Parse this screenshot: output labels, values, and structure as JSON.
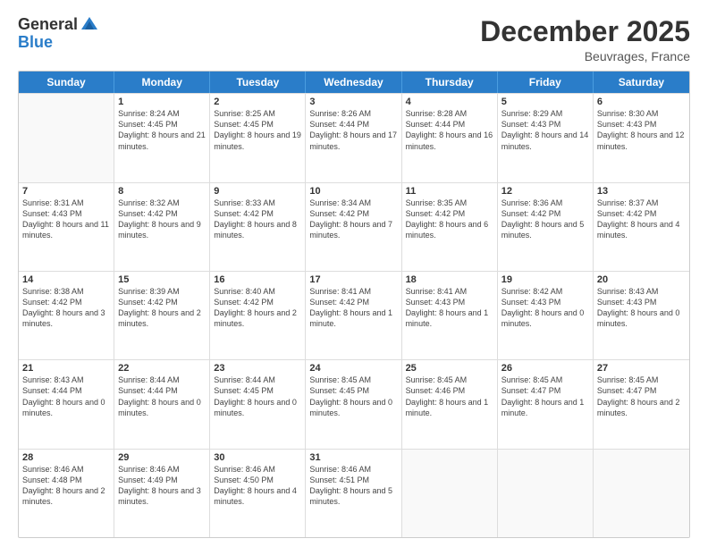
{
  "logo": {
    "general": "General",
    "blue": "Blue"
  },
  "title": {
    "month": "December 2025",
    "location": "Beuvrages, France"
  },
  "weekdays": [
    "Sunday",
    "Monday",
    "Tuesday",
    "Wednesday",
    "Thursday",
    "Friday",
    "Saturday"
  ],
  "weeks": [
    [
      {
        "day": "",
        "sunrise": "",
        "sunset": "",
        "daylight": "",
        "empty": true
      },
      {
        "day": "1",
        "sunrise": "Sunrise: 8:24 AM",
        "sunset": "Sunset: 4:45 PM",
        "daylight": "Daylight: 8 hours and 21 minutes.",
        "empty": false
      },
      {
        "day": "2",
        "sunrise": "Sunrise: 8:25 AM",
        "sunset": "Sunset: 4:45 PM",
        "daylight": "Daylight: 8 hours and 19 minutes.",
        "empty": false
      },
      {
        "day": "3",
        "sunrise": "Sunrise: 8:26 AM",
        "sunset": "Sunset: 4:44 PM",
        "daylight": "Daylight: 8 hours and 17 minutes.",
        "empty": false
      },
      {
        "day": "4",
        "sunrise": "Sunrise: 8:28 AM",
        "sunset": "Sunset: 4:44 PM",
        "daylight": "Daylight: 8 hours and 16 minutes.",
        "empty": false
      },
      {
        "day": "5",
        "sunrise": "Sunrise: 8:29 AM",
        "sunset": "Sunset: 4:43 PM",
        "daylight": "Daylight: 8 hours and 14 minutes.",
        "empty": false
      },
      {
        "day": "6",
        "sunrise": "Sunrise: 8:30 AM",
        "sunset": "Sunset: 4:43 PM",
        "daylight": "Daylight: 8 hours and 12 minutes.",
        "empty": false
      }
    ],
    [
      {
        "day": "7",
        "sunrise": "Sunrise: 8:31 AM",
        "sunset": "Sunset: 4:43 PM",
        "daylight": "Daylight: 8 hours and 11 minutes.",
        "empty": false
      },
      {
        "day": "8",
        "sunrise": "Sunrise: 8:32 AM",
        "sunset": "Sunset: 4:42 PM",
        "daylight": "Daylight: 8 hours and 9 minutes.",
        "empty": false
      },
      {
        "day": "9",
        "sunrise": "Sunrise: 8:33 AM",
        "sunset": "Sunset: 4:42 PM",
        "daylight": "Daylight: 8 hours and 8 minutes.",
        "empty": false
      },
      {
        "day": "10",
        "sunrise": "Sunrise: 8:34 AM",
        "sunset": "Sunset: 4:42 PM",
        "daylight": "Daylight: 8 hours and 7 minutes.",
        "empty": false
      },
      {
        "day": "11",
        "sunrise": "Sunrise: 8:35 AM",
        "sunset": "Sunset: 4:42 PM",
        "daylight": "Daylight: 8 hours and 6 minutes.",
        "empty": false
      },
      {
        "day": "12",
        "sunrise": "Sunrise: 8:36 AM",
        "sunset": "Sunset: 4:42 PM",
        "daylight": "Daylight: 8 hours and 5 minutes.",
        "empty": false
      },
      {
        "day": "13",
        "sunrise": "Sunrise: 8:37 AM",
        "sunset": "Sunset: 4:42 PM",
        "daylight": "Daylight: 8 hours and 4 minutes.",
        "empty": false
      }
    ],
    [
      {
        "day": "14",
        "sunrise": "Sunrise: 8:38 AM",
        "sunset": "Sunset: 4:42 PM",
        "daylight": "Daylight: 8 hours and 3 minutes.",
        "empty": false
      },
      {
        "day": "15",
        "sunrise": "Sunrise: 8:39 AM",
        "sunset": "Sunset: 4:42 PM",
        "daylight": "Daylight: 8 hours and 2 minutes.",
        "empty": false
      },
      {
        "day": "16",
        "sunrise": "Sunrise: 8:40 AM",
        "sunset": "Sunset: 4:42 PM",
        "daylight": "Daylight: 8 hours and 2 minutes.",
        "empty": false
      },
      {
        "day": "17",
        "sunrise": "Sunrise: 8:41 AM",
        "sunset": "Sunset: 4:42 PM",
        "daylight": "Daylight: 8 hours and 1 minute.",
        "empty": false
      },
      {
        "day": "18",
        "sunrise": "Sunrise: 8:41 AM",
        "sunset": "Sunset: 4:43 PM",
        "daylight": "Daylight: 8 hours and 1 minute.",
        "empty": false
      },
      {
        "day": "19",
        "sunrise": "Sunrise: 8:42 AM",
        "sunset": "Sunset: 4:43 PM",
        "daylight": "Daylight: 8 hours and 0 minutes.",
        "empty": false
      },
      {
        "day": "20",
        "sunrise": "Sunrise: 8:43 AM",
        "sunset": "Sunset: 4:43 PM",
        "daylight": "Daylight: 8 hours and 0 minutes.",
        "empty": false
      }
    ],
    [
      {
        "day": "21",
        "sunrise": "Sunrise: 8:43 AM",
        "sunset": "Sunset: 4:44 PM",
        "daylight": "Daylight: 8 hours and 0 minutes.",
        "empty": false
      },
      {
        "day": "22",
        "sunrise": "Sunrise: 8:44 AM",
        "sunset": "Sunset: 4:44 PM",
        "daylight": "Daylight: 8 hours and 0 minutes.",
        "empty": false
      },
      {
        "day": "23",
        "sunrise": "Sunrise: 8:44 AM",
        "sunset": "Sunset: 4:45 PM",
        "daylight": "Daylight: 8 hours and 0 minutes.",
        "empty": false
      },
      {
        "day": "24",
        "sunrise": "Sunrise: 8:45 AM",
        "sunset": "Sunset: 4:45 PM",
        "daylight": "Daylight: 8 hours and 0 minutes.",
        "empty": false
      },
      {
        "day": "25",
        "sunrise": "Sunrise: 8:45 AM",
        "sunset": "Sunset: 4:46 PM",
        "daylight": "Daylight: 8 hours and 1 minute.",
        "empty": false
      },
      {
        "day": "26",
        "sunrise": "Sunrise: 8:45 AM",
        "sunset": "Sunset: 4:47 PM",
        "daylight": "Daylight: 8 hours and 1 minute.",
        "empty": false
      },
      {
        "day": "27",
        "sunrise": "Sunrise: 8:45 AM",
        "sunset": "Sunset: 4:47 PM",
        "daylight": "Daylight: 8 hours and 2 minutes.",
        "empty": false
      }
    ],
    [
      {
        "day": "28",
        "sunrise": "Sunrise: 8:46 AM",
        "sunset": "Sunset: 4:48 PM",
        "daylight": "Daylight: 8 hours and 2 minutes.",
        "empty": false
      },
      {
        "day": "29",
        "sunrise": "Sunrise: 8:46 AM",
        "sunset": "Sunset: 4:49 PM",
        "daylight": "Daylight: 8 hours and 3 minutes.",
        "empty": false
      },
      {
        "day": "30",
        "sunrise": "Sunrise: 8:46 AM",
        "sunset": "Sunset: 4:50 PM",
        "daylight": "Daylight: 8 hours and 4 minutes.",
        "empty": false
      },
      {
        "day": "31",
        "sunrise": "Sunrise: 8:46 AM",
        "sunset": "Sunset: 4:51 PM",
        "daylight": "Daylight: 8 hours and 5 minutes.",
        "empty": false
      },
      {
        "day": "",
        "sunrise": "",
        "sunset": "",
        "daylight": "",
        "empty": true
      },
      {
        "day": "",
        "sunrise": "",
        "sunset": "",
        "daylight": "",
        "empty": true
      },
      {
        "day": "",
        "sunrise": "",
        "sunset": "",
        "daylight": "",
        "empty": true
      }
    ]
  ]
}
